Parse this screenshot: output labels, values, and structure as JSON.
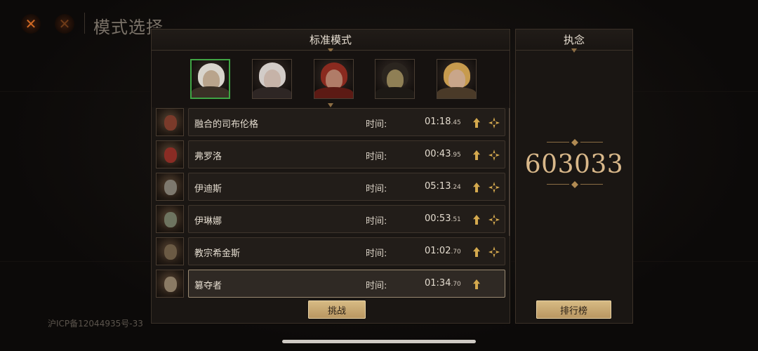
{
  "background": {
    "title": "模式选择",
    "icp": "沪ICP备12044935号-33"
  },
  "panel": {
    "title": "标准模式",
    "portraits": [
      {
        "name": "portrait-old-man",
        "selected": true,
        "skin": "#b9a48c",
        "hair": "#d8d4cc",
        "cloth": "#3a3026"
      },
      {
        "name": "portrait-white-hair-woman",
        "selected": false,
        "skin": "#c6b3a8",
        "hair": "#d2ccc8",
        "cloth": "#2e2624"
      },
      {
        "name": "portrait-red-hood",
        "selected": false,
        "skin": "#b07c68",
        "hair": "#8a2a1f",
        "cloth": "#5c1a14"
      },
      {
        "name": "portrait-hooded-mask",
        "selected": false,
        "skin": "#8f7f55",
        "hair": "#2b251f",
        "cloth": "#1d1915"
      },
      {
        "name": "portrait-blonde-figure",
        "selected": false,
        "skin": "#c9a68a",
        "hair": "#c79b4e",
        "cloth": "#4a3a28"
      }
    ],
    "bosses": [
      {
        "name": "融合的司布伦格",
        "time_label": "时间:",
        "time_main": "01:18",
        "time_ms": ".45",
        "has_star": true,
        "active": false,
        "thumb": "#7a3a2a"
      },
      {
        "name": "弗罗洛",
        "time_label": "时间:",
        "time_main": "00:43",
        "time_ms": ".95",
        "has_star": true,
        "active": false,
        "thumb": "#8a2c24"
      },
      {
        "name": "伊迪斯",
        "time_label": "时间:",
        "time_main": "05:13",
        "time_ms": ".24",
        "has_star": true,
        "active": false,
        "thumb": "#7d786e"
      },
      {
        "name": "伊琳娜",
        "time_label": "时间:",
        "time_main": "00:53",
        "time_ms": ".51",
        "has_star": true,
        "active": false,
        "thumb": "#6e7460"
      },
      {
        "name": "教宗希金斯",
        "time_label": "时间:",
        "time_main": "01:02",
        "time_ms": ".70",
        "has_star": true,
        "active": false,
        "thumb": "#6b5a44"
      },
      {
        "name": "篡夺者",
        "time_label": "时间:",
        "time_main": "01:34",
        "time_ms": ".70",
        "has_star": false,
        "active": true,
        "thumb": "#8a7a64"
      }
    ],
    "challenge_label": "挑战"
  },
  "side": {
    "title": "执念",
    "score": "603033",
    "leaderboard_label": "排行榜"
  },
  "colors": {
    "accent_gold": "#d4a94e",
    "selected_green": "#3fa444",
    "score_gold": "#d9b88a"
  }
}
